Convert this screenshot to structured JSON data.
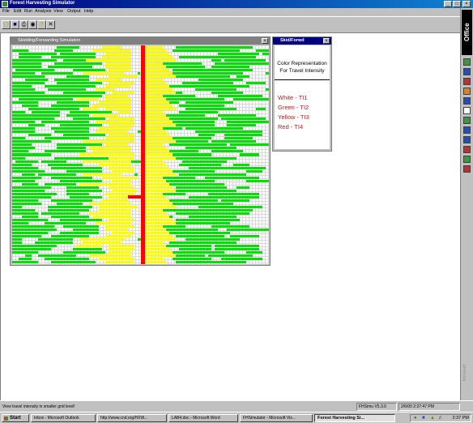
{
  "app": {
    "title": "Forest Harvesting Simulator",
    "window_buttons": [
      "_",
      "□",
      "×"
    ]
  },
  "menu": [
    "File",
    "Edit",
    "Run",
    "Analysis",
    "View",
    "Output",
    "Help"
  ],
  "toolbar": [
    "open-icon",
    "save-icon",
    "print-icon",
    "binoculars-icon",
    "help-icon",
    "close-icon"
  ],
  "office_bar": {
    "label": "Office",
    "watermark": "Microsoft"
  },
  "sim_window": {
    "title": "Skidding/Forwarding Simulation",
    "close": "×",
    "colors": {
      "white": "#ffffff",
      "green": "#00e000",
      "yellow": "#ffff00",
      "red": "#ff0000"
    },
    "road_col": 40,
    "cols": 80,
    "rows_data": [
      [
        [
          14,
          6
        ],
        [
          19,
          2
        ],
        [
          28,
          6
        ],
        [
          51,
          24
        ]
      ],
      [
        [
          0,
          5
        ],
        [
          13,
          6
        ],
        [
          25,
          12
        ],
        [
          50,
          21
        ],
        [
          76,
          4
        ]
      ],
      [
        [
          2,
          12
        ],
        [
          15,
          11
        ],
        [
          29,
          8
        ],
        [
          64,
          13
        ],
        [
          78,
          2
        ]
      ],
      [
        [
          2,
          7
        ],
        [
          12,
          14
        ],
        [
          28,
          9
        ],
        [
          52,
          24
        ]
      ],
      [
        [
          0,
          14
        ],
        [
          16,
          12
        ],
        [
          23,
          14
        ],
        [
          62,
          3
        ],
        [
          66,
          13
        ]
      ],
      [
        [
          0,
          9
        ],
        [
          13,
          15
        ],
        [
          29,
          8
        ],
        [
          46,
          13
        ],
        [
          63,
          17
        ]
      ],
      [
        [
          0,
          9
        ],
        [
          11,
          14
        ],
        [
          29,
          8
        ],
        [
          45,
          15
        ],
        [
          62,
          12
        ]
      ],
      [
        [
          1,
          12
        ],
        [
          19,
          10
        ],
        [
          30,
          7
        ],
        [
          50,
          15
        ],
        [
          64,
          11
        ]
      ],
      [
        [
          0,
          7
        ],
        [
          9,
          10
        ],
        [
          22,
          13
        ],
        [
          39,
          1
        ],
        [
          49,
          23
        ],
        [
          79,
          1
        ]
      ],
      [
        [
          0,
          10
        ],
        [
          17,
          7
        ],
        [
          30,
          9
        ],
        [
          50,
          18
        ],
        [
          70,
          4
        ]
      ],
      [
        [
          4,
          7
        ],
        [
          13,
          11
        ],
        [
          26,
          8
        ],
        [
          58,
          14
        ]
      ],
      [
        [
          0,
          10
        ],
        [
          14,
          14
        ],
        [
          30,
          8
        ],
        [
          53,
          16
        ],
        [
          73,
          6
        ]
      ],
      [
        [
          0,
          6
        ],
        [
          10,
          16
        ],
        [
          29,
          8
        ],
        [
          44,
          30
        ]
      ],
      [
        [
          0,
          7
        ],
        [
          11,
          12
        ],
        [
          26,
          6
        ],
        [
          57,
          13
        ],
        [
          79,
          1
        ]
      ],
      [
        [
          0,
          10
        ],
        [
          16,
          13
        ],
        [
          31,
          7
        ],
        [
          44,
          9
        ],
        [
          62,
          10
        ]
      ],
      [
        [
          0,
          19
        ],
        [
          18,
          10
        ],
        [
          29,
          7
        ],
        [
          47,
          10
        ],
        [
          64,
          14
        ]
      ],
      [
        [
          2,
          17
        ],
        [
          20,
          7
        ],
        [
          29,
          8
        ],
        [
          46,
          20
        ],
        [
          69,
          11
        ]
      ],
      [
        [
          0,
          8
        ],
        [
          14,
          10
        ],
        [
          27,
          10
        ],
        [
          43,
          9
        ],
        [
          54,
          15
        ]
      ],
      [
        [
          3,
          5
        ],
        [
          12,
          12
        ],
        [
          25,
          12
        ],
        [
          52,
          14
        ]
      ],
      [
        [
          5,
          16
        ],
        [
          22,
          5
        ],
        [
          29,
          8
        ],
        [
          54,
          16
        ],
        [
          76,
          3
        ]
      ],
      [
        [
          0,
          4
        ],
        [
          6,
          9
        ],
        [
          18,
          13
        ],
        [
          33,
          4
        ],
        [
          52,
          12
        ]
      ],
      [
        [
          0,
          15
        ],
        [
          17,
          7
        ],
        [
          25,
          8
        ],
        [
          45,
          15
        ],
        [
          64,
          12
        ]
      ],
      [
        [
          0,
          13
        ],
        [
          19,
          10
        ],
        [
          30,
          8
        ],
        [
          47,
          17
        ],
        [
          65,
          14
        ]
      ],
      [
        [
          0,
          7
        ],
        [
          9,
          15
        ],
        [
          26,
          12
        ],
        [
          47,
          16
        ],
        [
          67,
          13
        ]
      ],
      [
        [
          5,
          5
        ],
        [
          15,
          13
        ],
        [
          30,
          8
        ],
        [
          50,
          13
        ],
        [
          67,
          9
        ]
      ],
      [
        [
          0,
          7
        ],
        [
          12,
          12
        ],
        [
          27,
          10
        ],
        [
          43,
          10
        ],
        [
          54,
          18
        ]
      ],
      [
        [
          0,
          7
        ],
        [
          13,
          11
        ],
        [
          26,
          10
        ],
        [
          39,
          2
        ],
        [
          57,
          21
        ]
      ],
      [
        [
          5,
          7
        ],
        [
          16,
          13
        ],
        [
          30,
          8
        ],
        [
          58,
          5
        ],
        [
          66,
          12
        ]
      ],
      [
        [
          0,
          4
        ],
        [
          10,
          14
        ],
        [
          29,
          9
        ],
        [
          45,
          17
        ],
        [
          66,
          9
        ]
      ],
      [
        [
          0,
          12
        ],
        [
          22,
          8
        ],
        [
          29,
          9
        ],
        [
          45,
          16
        ],
        [
          62,
          14
        ]
      ],
      [
        [
          0,
          6
        ],
        [
          14,
          14
        ],
        [
          29,
          7
        ],
        [
          49,
          18
        ],
        [
          68,
          12
        ]
      ],
      [
        [
          0,
          7
        ],
        [
          14,
          9
        ],
        [
          24,
          13
        ],
        [
          42,
          6
        ],
        [
          54,
          16
        ]
      ],
      [
        [
          0,
          5
        ],
        [
          10,
          13
        ],
        [
          25,
          12
        ],
        [
          48,
          10
        ],
        [
          62,
          10
        ]
      ],
      [
        [
          0,
          12
        ],
        [
          21,
          8
        ],
        [
          29,
          9
        ],
        [
          45,
          17
        ],
        [
          71,
          6
        ]
      ],
      [
        [
          0,
          4
        ],
        [
          13,
          17
        ],
        [
          30,
          8
        ],
        [
          48,
          22
        ]
      ],
      [
        [
          1,
          7
        ],
        [
          9,
          8
        ],
        [
          22,
          17
        ],
        [
          37,
          4
        ],
        [
          53,
          14
        ]
      ],
      [
        [
          0,
          6
        ],
        [
          11,
          11
        ],
        [
          27,
          10
        ],
        [
          52,
          13
        ],
        [
          69,
          5
        ]
      ],
      [
        [
          0,
          8
        ],
        [
          12,
          16
        ],
        [
          30,
          8
        ],
        [
          55,
          24
        ]
      ],
      [
        [
          0,
          10
        ],
        [
          17,
          11
        ],
        [
          31,
          7
        ],
        [
          47,
          16
        ],
        [
          73,
          5
        ]
      ],
      [
        [
          3,
          4
        ],
        [
          8,
          12
        ],
        [
          22,
          12
        ],
        [
          38,
          1
        ],
        [
          52,
          21
        ]
      ],
      [
        [
          0,
          9
        ],
        [
          12,
          13
        ],
        [
          28,
          11
        ],
        [
          45,
          12
        ],
        [
          60,
          17
        ]
      ],
      [
        [
          0,
          7
        ],
        [
          15,
          13
        ],
        [
          31,
          6
        ],
        [
          45,
          18
        ],
        [
          73,
          7
        ]
      ],
      [
        [
          3,
          5
        ],
        [
          10,
          10
        ],
        [
          21,
          16
        ],
        [
          45,
          1
        ],
        [
          48,
          18
        ]
      ],
      [
        [
          0,
          12
        ],
        [
          17,
          10
        ],
        [
          30,
          8
        ],
        [
          51,
          16
        ],
        [
          70,
          4
        ]
      ],
      [
        [
          0,
          10
        ],
        [
          17,
          11
        ],
        [
          31,
          8
        ],
        [
          45,
          25
        ]
      ],
      [
        [
          0,
          14
        ],
        [
          17,
          7
        ],
        [
          29,
          9
        ],
        [
          44,
          10
        ],
        [
          61,
          16
        ]
      ],
      [
        [
          0,
          12
        ],
        [
          18,
          10
        ],
        [
          30,
          8
        ],
        [
          55,
          22
        ]
      ],
      [
        [
          0,
          8
        ],
        [
          12,
          13
        ],
        [
          28,
          8
        ],
        [
          47,
          17
        ],
        [
          65,
          9
        ]
      ],
      [
        [
          0,
          9
        ],
        [
          14,
          8
        ],
        [
          24,
          13
        ],
        [
          40,
          6
        ],
        [
          50,
          19
        ]
      ],
      [
        [
          0,
          3
        ],
        [
          11,
          14
        ],
        [
          27,
          12
        ],
        [
          58,
          20
        ]
      ],
      [
        [
          0,
          7
        ],
        [
          11,
          13
        ],
        [
          27,
          10
        ],
        [
          45,
          15
        ],
        [
          60,
          15
        ]
      ],
      [
        [
          0,
          8
        ],
        [
          9,
          12
        ],
        [
          24,
          13
        ],
        [
          42,
          6
        ],
        [
          51,
          23
        ]
      ],
      [
        [
          3,
          5
        ],
        [
          12,
          12
        ],
        [
          25,
          12
        ],
        [
          45,
          5
        ],
        [
          55,
          15
        ]
      ],
      [
        [
          0,
          11
        ],
        [
          15,
          13
        ],
        [
          30,
          8
        ],
        [
          51,
          20
        ]
      ],
      [
        [
          0,
          5
        ],
        [
          10,
          13
        ],
        [
          26,
          11
        ],
        [
          41,
          6
        ],
        [
          51,
          17
        ]
      ],
      [
        [
          0,
          13
        ],
        [
          16,
          11
        ],
        [
          29,
          9
        ],
        [
          44,
          10
        ],
        [
          62,
          12
        ]
      ],
      [
        [
          0,
          14
        ],
        [
          19,
          8
        ],
        [
          29,
          7
        ],
        [
          48,
          16
        ],
        [
          67,
          13
        ]
      ],
      [
        [
          0,
          11
        ],
        [
          15,
          12
        ],
        [
          31,
          7
        ],
        [
          44,
          24
        ]
      ],
      [
        [
          0,
          9
        ],
        [
          12,
          12
        ],
        [
          29,
          8
        ],
        [
          51,
          15
        ],
        [
          68,
          9
        ]
      ],
      [
        [
          0,
          3
        ],
        [
          8,
          11
        ],
        [
          21,
          14
        ],
        [
          39,
          4
        ],
        [
          54,
          17
        ]
      ],
      [
        [
          0,
          3
        ],
        [
          7,
          12
        ],
        [
          22,
          12
        ],
        [
          49,
          21
        ]
      ],
      [
        [
          0,
          14
        ],
        [
          20,
          8
        ],
        [
          30,
          8
        ],
        [
          45,
          17
        ],
        [
          63,
          14
        ]
      ],
      [
        [
          0,
          12
        ],
        [
          19,
          9
        ],
        [
          30,
          8
        ],
        [
          52,
          10
        ],
        [
          63,
          14
        ]
      ],
      [
        [
          0,
          8
        ],
        [
          16,
          13
        ],
        [
          30,
          7
        ],
        [
          46,
          20
        ],
        [
          73,
          5
        ]
      ],
      [
        [
          4,
          2
        ],
        [
          8,
          12
        ],
        [
          24,
          13
        ],
        [
          46,
          14
        ],
        [
          61,
          14
        ]
      ],
      [
        [
          2,
          4
        ],
        [
          10,
          14
        ],
        [
          27,
          11
        ],
        [
          50,
          12
        ],
        [
          65,
          13
        ]
      ],
      [
        [
          0,
          8
        ],
        [
          12,
          14
        ],
        [
          29,
          9
        ],
        [
          51,
          22
        ]
      ]
    ],
    "red_stubs": [
      [
        46,
        36,
        40
      ]
    ]
  },
  "legend_window": {
    "title": "Skid/Forwd",
    "close": "×",
    "heading_1": "Color Representation",
    "heading_2": "For Travel Intensity",
    "items": [
      "White - TI1",
      "Green - TI2",
      "Yellow - TI3",
      "Red - TI4"
    ]
  },
  "status": {
    "message": "View travel intensity in smaller grid level!",
    "version": "FHSimu V5.3.0",
    "datetime": "2/6/00 2:37:47 PM"
  },
  "taskbar": {
    "start": "Start",
    "tasks": [
      "Inbox - Microsoft Outlook",
      "http://www.cnd.org/HXW...",
      "LAB4.doc - Microsoft Word",
      "FHSimulator - Microsoft Vis...",
      "Forest Harvesting Si..."
    ],
    "clock": "2:37 PM"
  }
}
